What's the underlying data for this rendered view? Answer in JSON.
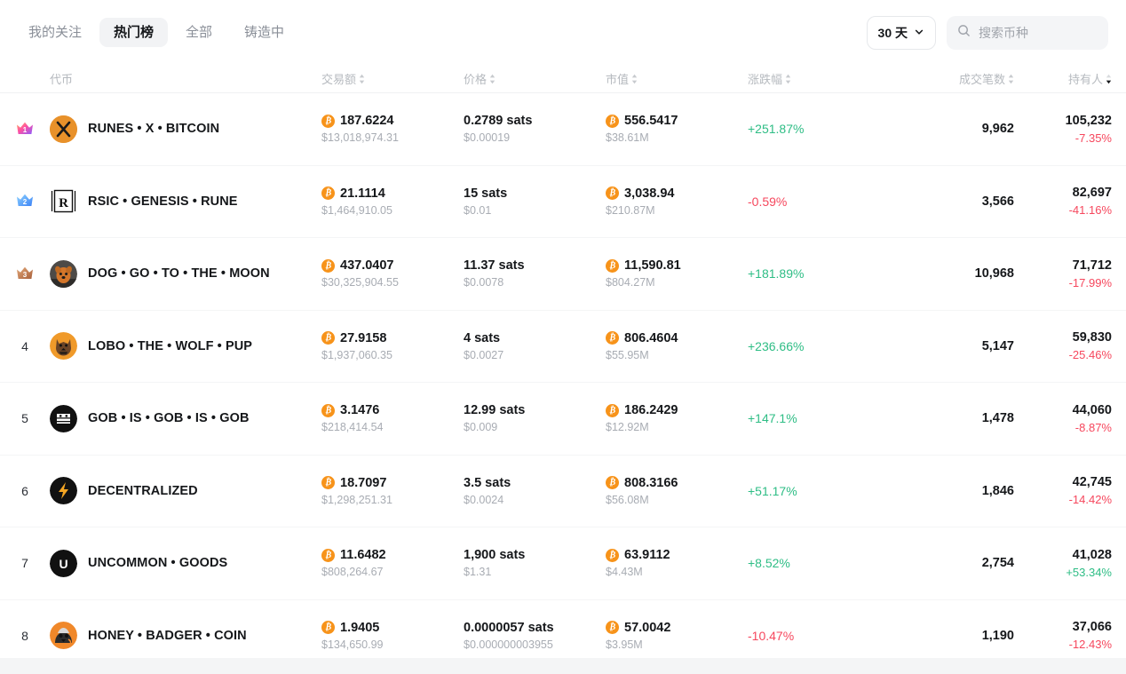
{
  "header": {
    "tabs": [
      {
        "label": "我的关注",
        "active": false
      },
      {
        "label": "热门榜",
        "active": true
      },
      {
        "label": "全部",
        "active": false
      },
      {
        "label": "铸造中",
        "active": false
      }
    ],
    "period": {
      "label": "30 天",
      "icon": "chevron-down-icon"
    },
    "search": {
      "placeholder": "搜索币种",
      "value": "",
      "icon": "search-icon"
    }
  },
  "table": {
    "columns": [
      {
        "key": "rank",
        "label": "",
        "sortable": false,
        "align": "center"
      },
      {
        "key": "token",
        "label": "代币",
        "sortable": false,
        "align": "left"
      },
      {
        "key": "volume",
        "label": "交易额",
        "sortable": true,
        "align": "left"
      },
      {
        "key": "price",
        "label": "价格",
        "sortable": true,
        "align": "left"
      },
      {
        "key": "marketcap",
        "label": "市值",
        "sortable": true,
        "align": "left"
      },
      {
        "key": "change",
        "label": "涨跌幅",
        "sortable": true,
        "align": "left"
      },
      {
        "key": "trades",
        "label": "成交笔数",
        "sortable": true,
        "align": "right"
      },
      {
        "key": "holders",
        "label": "持有人",
        "sortable": true,
        "align": "right",
        "sorted": "desc"
      }
    ],
    "rows": [
      {
        "rank": "1",
        "rank_badge": "crown-gold-1",
        "name": "RUNES • X • BITCOIN",
        "avatar": "x-logo-orange-avatar",
        "volume_btc": "187.6224",
        "volume_usd": "$13,018,974.31",
        "price_sats": "0.2789 sats",
        "price_usd": "$0.00019",
        "mcap_btc": "556.5417",
        "mcap_usd": "$38.61M",
        "change": "+251.87%",
        "change_dir": "up",
        "trades": "9,962",
        "holders": "105,232",
        "holders_change": "-7.35%",
        "holders_dir": "down"
      },
      {
        "rank": "2",
        "rank_badge": "crown-silver-2",
        "name": "RSIC • GENESIS • RUNE",
        "avatar": "rsic-square-avatar",
        "volume_btc": "21.1114",
        "volume_usd": "$1,464,910.05",
        "price_sats": "15 sats",
        "price_usd": "$0.01",
        "mcap_btc": "3,038.94",
        "mcap_usd": "$210.87M",
        "change": "-0.59%",
        "change_dir": "down",
        "trades": "3,566",
        "holders": "82,697",
        "holders_change": "-41.16%",
        "holders_dir": "down"
      },
      {
        "rank": "3",
        "rank_badge": "crown-bronze-3",
        "name": "DOG • GO • TO • THE • MOON",
        "avatar": "dog-photo-avatar",
        "volume_btc": "437.0407",
        "volume_usd": "$30,325,904.55",
        "price_sats": "11.37 sats",
        "price_usd": "$0.0078",
        "mcap_btc": "11,590.81",
        "mcap_usd": "$804.27M",
        "change": "+181.89%",
        "change_dir": "up",
        "trades": "10,968",
        "holders": "71,712",
        "holders_change": "-17.99%",
        "holders_dir": "down"
      },
      {
        "rank": "4",
        "rank_badge": "",
        "name": "LOBO • THE • WOLF • PUP",
        "avatar": "wolf-orange-avatar",
        "volume_btc": "27.9158",
        "volume_usd": "$1,937,060.35",
        "price_sats": "4 sats",
        "price_usd": "$0.0027",
        "mcap_btc": "806.4604",
        "mcap_usd": "$55.95M",
        "change": "+236.66%",
        "change_dir": "up",
        "trades": "5,147",
        "holders": "59,830",
        "holders_change": "-25.46%",
        "holders_dir": "down"
      },
      {
        "rank": "5",
        "rank_badge": "",
        "name": "GOB • IS • GOB • IS • GOB",
        "avatar": "gob-black-avatar",
        "volume_btc": "3.1476",
        "volume_usd": "$218,414.54",
        "price_sats": "12.99 sats",
        "price_usd": "$0.009",
        "mcap_btc": "186.2429",
        "mcap_usd": "$12.92M",
        "change": "+147.1%",
        "change_dir": "up",
        "trades": "1,478",
        "holders": "44,060",
        "holders_change": "-8.87%",
        "holders_dir": "down"
      },
      {
        "rank": "6",
        "rank_badge": "",
        "name": "DECENTRALIZED",
        "avatar": "lightning-black-avatar",
        "volume_btc": "18.7097",
        "volume_usd": "$1,298,251.31",
        "price_sats": "3.5 sats",
        "price_usd": "$0.0024",
        "mcap_btc": "808.3166",
        "mcap_usd": "$56.08M",
        "change": "+51.17%",
        "change_dir": "up",
        "trades": "1,846",
        "holders": "42,745",
        "holders_change": "-14.42%",
        "holders_dir": "down"
      },
      {
        "rank": "7",
        "rank_badge": "",
        "name": "UNCOMMON • GOODS",
        "avatar": "uncommon-u-black-avatar",
        "volume_btc": "11.6482",
        "volume_usd": "$808,264.67",
        "price_sats": "1,900 sats",
        "price_usd": "$1.31",
        "mcap_btc": "63.9112",
        "mcap_usd": "$4.43M",
        "change": "+8.52%",
        "change_dir": "up",
        "trades": "2,754",
        "holders": "41,028",
        "holders_change": "+53.34%",
        "holders_dir": "up"
      },
      {
        "rank": "8",
        "rank_badge": "",
        "name": "HONEY • BADGER • COIN",
        "avatar": "honey-badger-avatar",
        "volume_btc": "1.9405",
        "volume_usd": "$134,650.99",
        "price_sats": "0.0000057 sats",
        "price_usd": "$0.000000003955",
        "mcap_btc": "57.0042",
        "mcap_usd": "$3.95M",
        "change": "-10.47%",
        "change_dir": "down",
        "trades": "1,190",
        "holders": "37,066",
        "holders_change": "-12.43%",
        "holders_dir": "down"
      }
    ]
  },
  "colors": {
    "up": "#2ebd85",
    "down": "#f6475d",
    "bitcoin_orange": "#f7931a",
    "text_primary": "#15171a",
    "text_muted": "#a8acb3"
  }
}
